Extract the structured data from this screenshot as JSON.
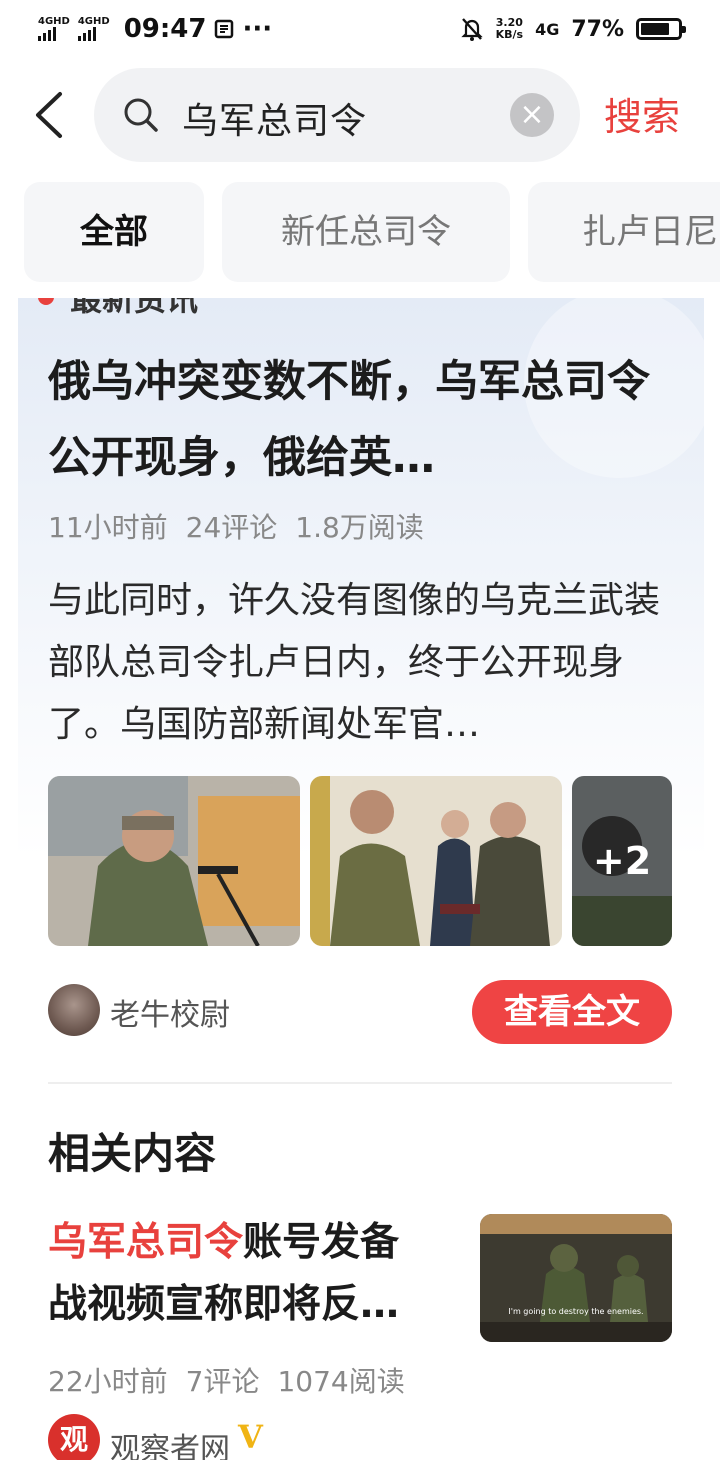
{
  "status_bar": {
    "net1": "4GHD",
    "net2": "4GHD",
    "time": "09:47",
    "more": "···",
    "speed_value": "3.20",
    "speed_unit": "KB/s",
    "network": "4G",
    "battery_percent": "77%",
    "battery_level": 0.77
  },
  "search": {
    "query": "乌军总司令",
    "submit_label": "搜索"
  },
  "tabs": [
    {
      "label": "全部"
    },
    {
      "label": "新任总司令"
    },
    {
      "label": "扎卢日尼"
    }
  ],
  "card": {
    "badge": "最新资讯",
    "headline": "俄乌冲突变数不断，乌军总司令公开现身，俄给英…",
    "meta": {
      "time": "11小时前",
      "comments": "24评论",
      "reads": "1.8万阅读"
    },
    "summary": "与此同时，许久没有图像的乌克兰武装部队总司令扎卢日内，终于公开现身了。乌国防部新闻处军官…",
    "more_images": "+2",
    "author": "老牛校尉",
    "read_full": "查看全文"
  },
  "related": {
    "section_title": "相关内容",
    "item": {
      "title_highlight": "乌军总司令",
      "title_rest": "账号发备战视频宣称即将反…",
      "thumb_caption": "I'm going to destroy the enemies.",
      "meta": {
        "time": "22小时前",
        "comments": "7评论",
        "reads": "1074阅读"
      },
      "author": "观察者网",
      "avatar_char": "观",
      "verified_mark": "V"
    }
  },
  "colors": {
    "accent": "#e8413d",
    "button": "#ef4444",
    "verified": "#f0b414"
  }
}
